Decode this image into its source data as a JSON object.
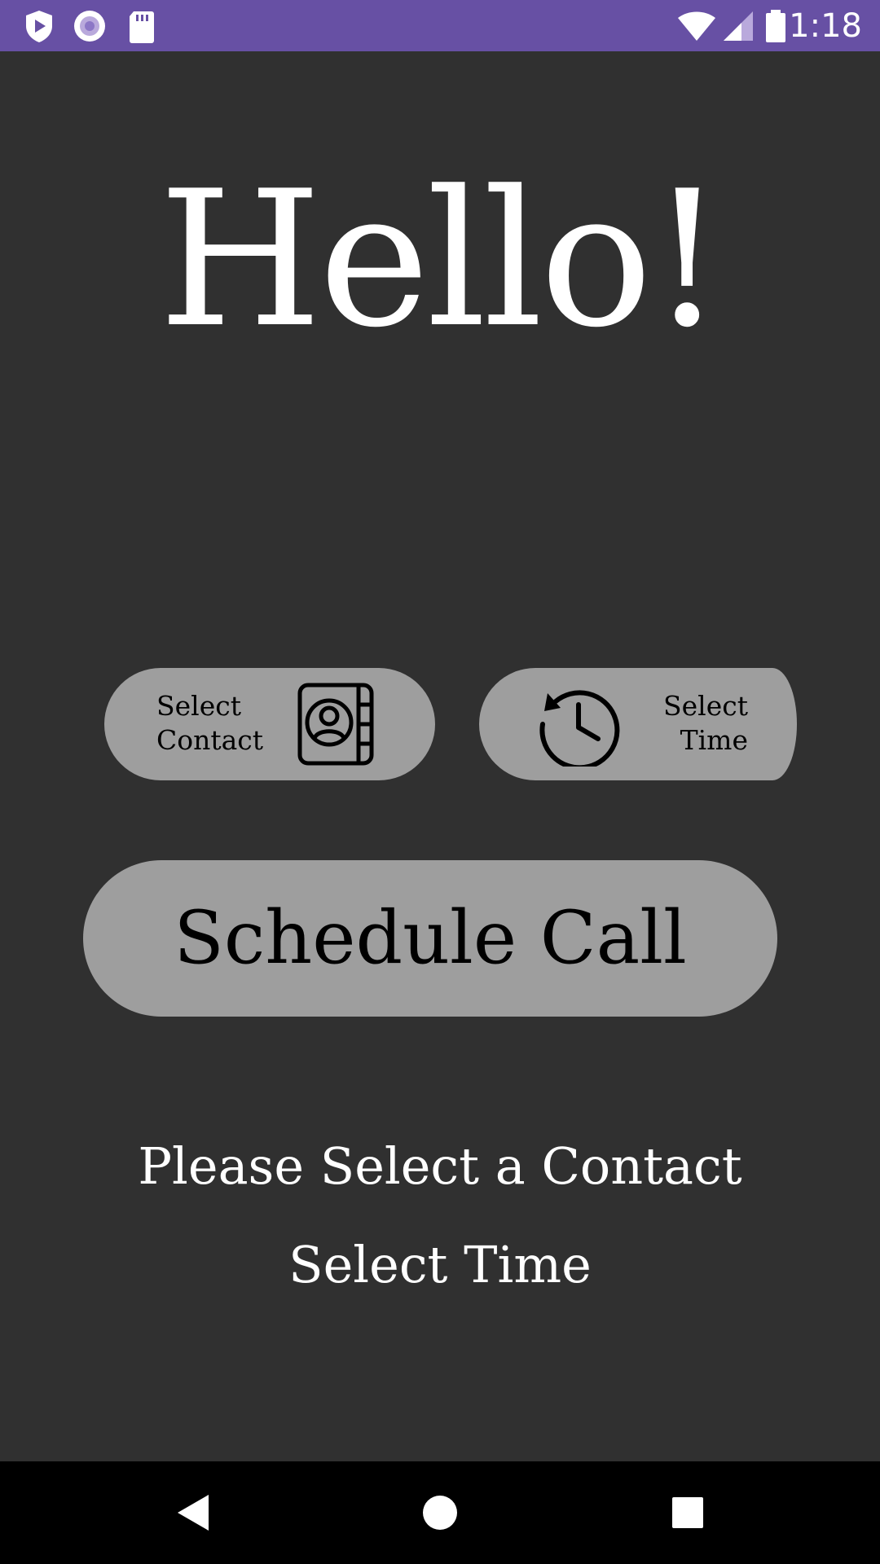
{
  "status_bar": {
    "time": "1:18",
    "left_icons": [
      "play-shield-icon",
      "record-icon",
      "sd-card-icon"
    ],
    "right_icons": [
      "wifi-icon",
      "cell-signal-icon",
      "battery-icon"
    ],
    "color": "#6750a4"
  },
  "main": {
    "greeting": "Hello!",
    "select_contact_button": {
      "line1": "Select",
      "line2": "Contact",
      "icon": "contact-book-icon"
    },
    "select_time_button": {
      "line1": "Select",
      "line2": "Time",
      "icon": "clock-history-icon"
    },
    "schedule_button": "Schedule Call",
    "contact_status": "Please Select a Contact",
    "time_status": "Select Time"
  },
  "nav_bar": {
    "buttons": [
      "back-icon",
      "home-icon",
      "recents-icon"
    ]
  },
  "colors": {
    "background": "#303030",
    "button": "#9e9e9e",
    "text": "#ffffff"
  }
}
